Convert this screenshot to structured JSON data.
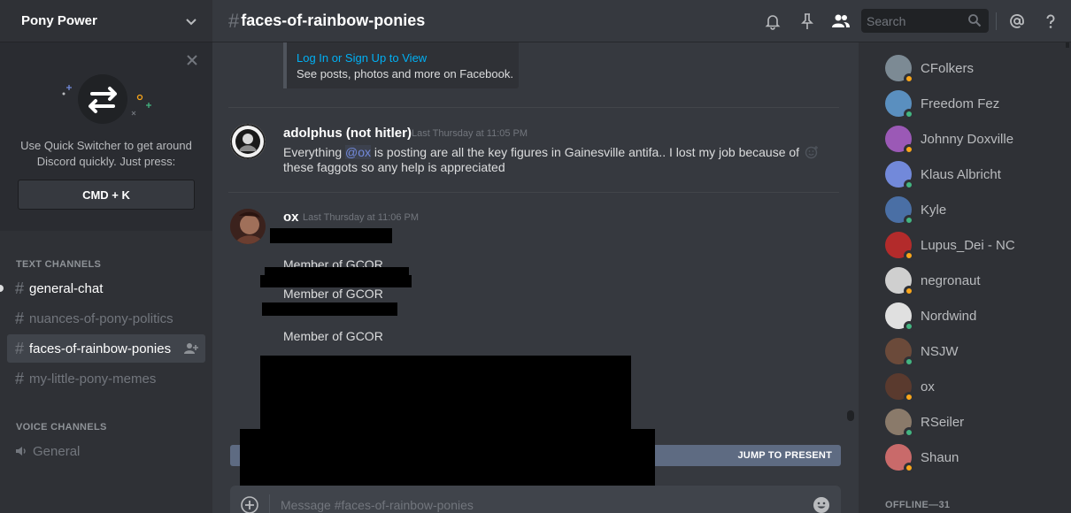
{
  "server": {
    "name": "Pony Power"
  },
  "quick_switcher": {
    "text": "Use Quick Switcher to get around Discord quickly. Just press:",
    "shortcut": "CMD + K"
  },
  "channels": {
    "text_category": "TEXT CHANNELS",
    "text": [
      {
        "name": "general-chat",
        "state": "unread"
      },
      {
        "name": "nuances-of-pony-politics",
        "state": "normal"
      },
      {
        "name": "faces-of-rainbow-ponies",
        "state": "active"
      },
      {
        "name": "my-little-pony-memes",
        "state": "normal"
      }
    ],
    "voice_category": "VOICE CHANNELS",
    "voice": [
      {
        "name": "General"
      }
    ]
  },
  "header": {
    "hash": "#",
    "channel": "faces-of-rainbow-ponies",
    "search_placeholder": "Search",
    "icons": [
      "bell-icon",
      "pin-icon",
      "members-icon",
      "search-icon",
      "mention-icon",
      "help-icon"
    ]
  },
  "embed": {
    "link": "Log In or Sign Up to View",
    "description": "See posts, photos and more on Facebook."
  },
  "messages": [
    {
      "author": "adolphus (not hitler)",
      "timestamp": "Last Thursday at 11:05 PM",
      "text_before": "Everything ",
      "mention": "@ox",
      "text_after": " is posting are all the key figures in Gainesville antifa.. I lost my job because of these faggots so any help is appreciated"
    },
    {
      "author": "ox",
      "timestamp": "Last Thursday at 11:06 PM",
      "lines": [
        "Member of GCOR",
        "Member of GCOR",
        "Member of GCOR"
      ]
    }
  ],
  "jump_label": "JUMP TO PRESENT",
  "composer_placeholder": "Message #faces-of-rainbow-ponies",
  "members": {
    "online": [
      {
        "name": "CFolkers",
        "status": "idle"
      },
      {
        "name": "Freedom Fez",
        "status": "online"
      },
      {
        "name": "Johnny Doxville",
        "status": "idle"
      },
      {
        "name": "Klaus Albricht",
        "status": "online"
      },
      {
        "name": "Kyle",
        "status": "online"
      },
      {
        "name": "Lupus_Dei - NC",
        "status": "idle"
      },
      {
        "name": "negronaut",
        "status": "idle"
      },
      {
        "name": "Nordwind",
        "status": "online"
      },
      {
        "name": "NSJW",
        "status": "online"
      },
      {
        "name": "ox",
        "status": "idle"
      },
      {
        "name": "RSeiler",
        "status": "online"
      },
      {
        "name": "Shaun",
        "status": "idle"
      }
    ],
    "offline_label": "OFFLINE—31"
  },
  "colors": {
    "online": "#43b581",
    "idle": "#faa61a",
    "mention": "#7289da",
    "link": "#00b0f4"
  }
}
